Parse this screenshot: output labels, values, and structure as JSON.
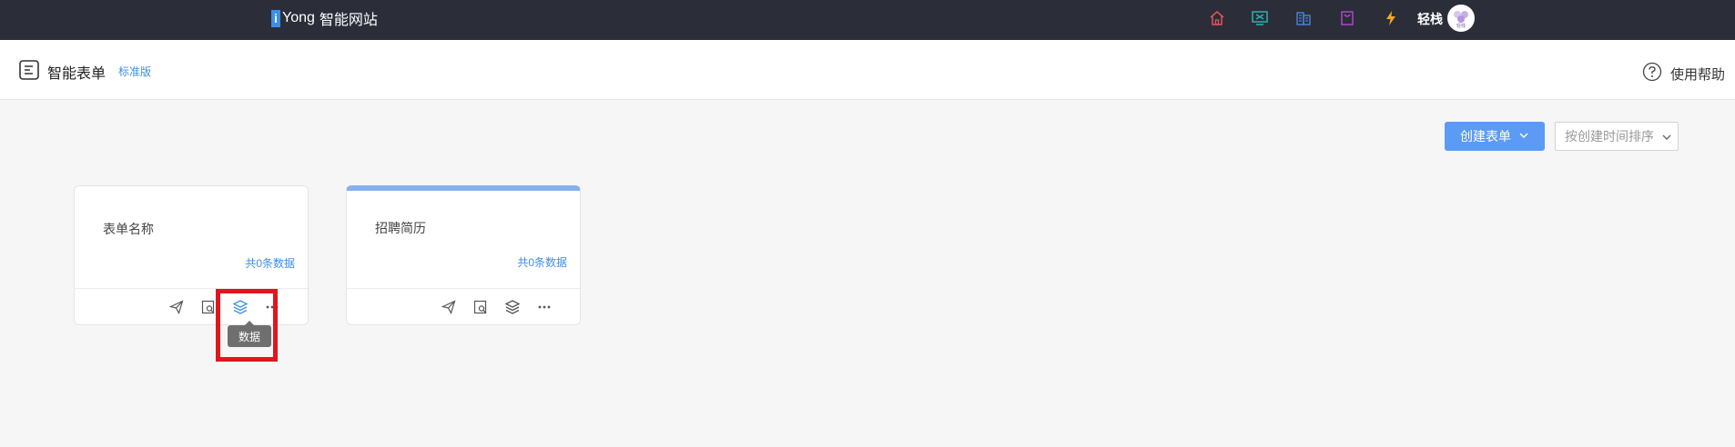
{
  "topbar": {
    "brand_mark": "i",
    "brand_name": "Yong",
    "brand_suffix": "智能网站",
    "icons": [
      "home-icon",
      "monitor-icon",
      "building-icon",
      "bag-icon",
      "lightning-icon"
    ],
    "username": "轻栈",
    "avatar_text": "轻栈"
  },
  "header": {
    "title": "智能表单",
    "edition": "标准版",
    "help_label": "使用帮助"
  },
  "toolbar": {
    "create_label": "创建表单",
    "sort_value": "按创建时间排序"
  },
  "cards": [
    {
      "name": "表单名称",
      "count_label": "共0条数据"
    },
    {
      "name": "招聘简历",
      "count_label": "共0条数据"
    }
  ],
  "tooltip": {
    "label": "数据"
  },
  "colors": {
    "topbar_bg": "#2b2d38",
    "accent": "#3d8ee8",
    "button_blue": "#5b9bf5",
    "highlight_red": "#e0161f"
  }
}
